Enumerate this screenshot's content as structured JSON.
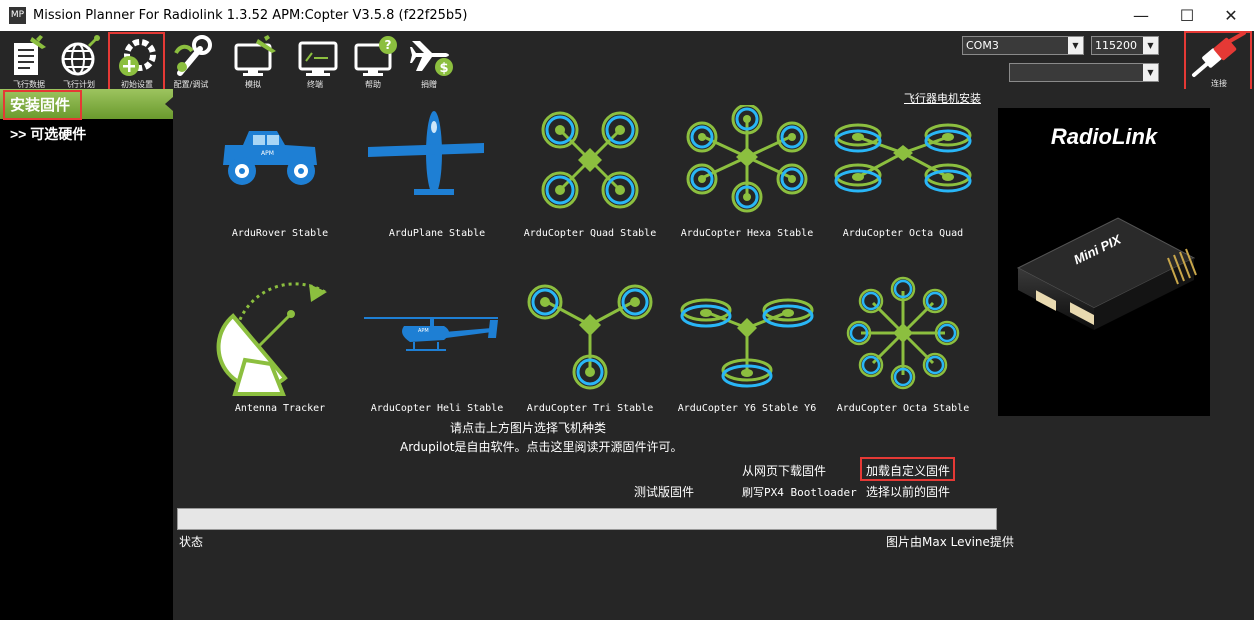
{
  "window": {
    "title": "Mission Planner For Radiolink 1.3.52 APM:Copter V3.5.8 (f22f25b5)",
    "app_icon_text": "MP",
    "minimize": "—",
    "maximize": "☐",
    "close": "✕"
  },
  "toolbar": {
    "items": [
      {
        "label": "飞行数据"
      },
      {
        "label": "飞行计划"
      },
      {
        "label": "初始设置"
      },
      {
        "label": "配置/调试"
      },
      {
        "label": "模拟"
      },
      {
        "label": "终端"
      },
      {
        "label": "帮助"
      },
      {
        "label": "捐赠"
      }
    ],
    "port": "COM3",
    "baud": "115200",
    "extra": "",
    "connect_label": "连接"
  },
  "sidebar": {
    "active": "安装固件",
    "items": [
      {
        "label": ">> 可选硬件"
      }
    ]
  },
  "main": {
    "motor_link": "飞行器电机安装",
    "firmware": [
      {
        "label": "ArduRover Stable"
      },
      {
        "label": "ArduPlane Stable"
      },
      {
        "label": "ArduCopter Quad Stable"
      },
      {
        "label": "ArduCopter Hexa Stable"
      },
      {
        "label": "ArduCopter Octa Quad"
      },
      {
        "label": "Antenna Tracker"
      },
      {
        "label": "ArduCopter Heli Stable"
      },
      {
        "label": "ArduCopter Tri Stable"
      },
      {
        "label": "ArduCopter Y6 Stable Y6"
      },
      {
        "label": "ArduCopter Octa Stable"
      }
    ],
    "select_hint": "请点击上方图片选择飞机种类",
    "license_text": "Ardupilot是自由软件。点击这里阅读开源固件许可。",
    "download_web": "从网页下载固件",
    "load_custom": "加载自定义固件",
    "beta": "测试版固件",
    "px4_bootloader": "刷写PX4 Bootloader",
    "previous": "选择以前的固件",
    "status_label": "状态",
    "credit": "图片由Max Levine提供"
  },
  "promo": {
    "brand": "RadioLink",
    "product": "Mini PIX"
  },
  "colors": {
    "accent_green": "#8cbf3f",
    "icon_blue": "#1e7fd4",
    "icon_cyan": "#29b6f6",
    "highlight_red": "#e53935"
  }
}
